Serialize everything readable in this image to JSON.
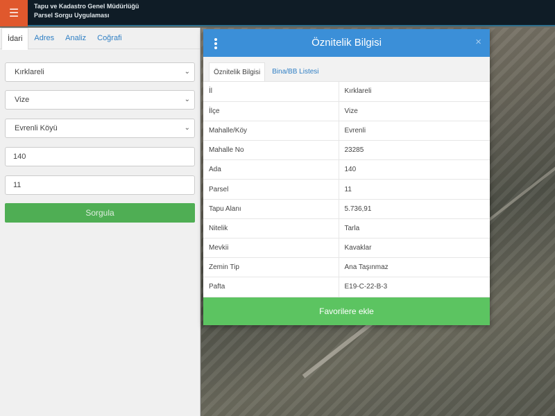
{
  "header": {
    "menu_icon": "☰",
    "brand_line1": "Tapu ve Kadastro Genel Müdürlüğü",
    "brand_line2": "Parsel Sorgu Uygulaması"
  },
  "left_panel": {
    "tabs": [
      "İdari",
      "Adres",
      "Analiz",
      "Coğrafi"
    ],
    "fields": {
      "il": "Kırklareli",
      "ilce": "Vize",
      "mahalle": "Evrenli Köyü",
      "ada": "140",
      "parsel": "11"
    },
    "query_button": "Sorgula"
  },
  "modal": {
    "title": "Öznitelik Bilgisi",
    "close": "×",
    "tabs": [
      "Öznitelik Bilgisi",
      "Bina/BB Listesi"
    ],
    "rows": [
      {
        "key": "İl",
        "value": "Kırklareli"
      },
      {
        "key": "İlçe",
        "value": "Vize"
      },
      {
        "key": "Mahalle/Köy",
        "value": "Evrenli"
      },
      {
        "key": "Mahalle No",
        "value": "23285"
      },
      {
        "key": "Ada",
        "value": "140"
      },
      {
        "key": "Parsel",
        "value": "11"
      },
      {
        "key": "Tapu Alanı",
        "value": "5.736,91"
      },
      {
        "key": "Nitelik",
        "value": "Tarla"
      },
      {
        "key": "Mevkii",
        "value": "Kavaklar"
      },
      {
        "key": "Zemin Tip",
        "value": "Ana Taşınmaz"
      },
      {
        "key": "Pafta",
        "value": "E19-C-22-B-3"
      }
    ],
    "favorite_button": "Favorilere ekle"
  },
  "colors": {
    "header_bg": "#0f1c26",
    "menu_accent": "#e0582d",
    "modal_header": "#3b8fd8",
    "button_green": "#4fae54",
    "fav_green": "#5cc461"
  }
}
